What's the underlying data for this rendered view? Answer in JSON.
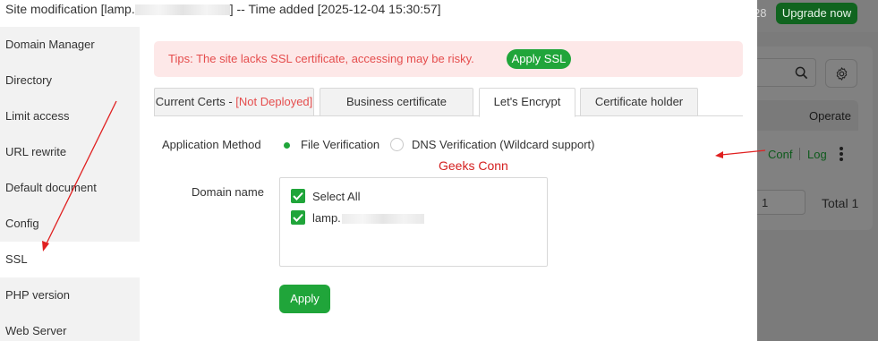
{
  "background": {
    "top_number": "28",
    "upgrade_label": "Upgrade now",
    "operate_header": "Operate",
    "conf_link": "Conf",
    "log_link": "Log",
    "page_number": "1",
    "total_label": "Total 1"
  },
  "modal": {
    "title_prefix": "Site modification [lamp.",
    "title_suffix": "] -- Time added [2025-12-04 15:30:57]"
  },
  "sidebar": {
    "items": [
      {
        "label": "Domain Manager",
        "active": false
      },
      {
        "label": "Directory",
        "active": false
      },
      {
        "label": "Limit access",
        "active": false
      },
      {
        "label": "URL rewrite",
        "active": false
      },
      {
        "label": "Default document",
        "active": false
      },
      {
        "label": "Config",
        "active": false
      },
      {
        "label": "SSL",
        "active": true
      },
      {
        "label": "PHP version",
        "active": false
      },
      {
        "label": "Web Server",
        "active": false
      }
    ]
  },
  "tips": {
    "text": "Tips: The site lacks SSL certificate, accessing may be risky.",
    "button": "Apply SSL"
  },
  "tabs": [
    {
      "label": "Current Certs - ",
      "badge": "[Not Deployed]",
      "active": false
    },
    {
      "label": "Business certificate",
      "badge": "",
      "active": false
    },
    {
      "label": "Let's Encrypt",
      "badge": "",
      "active": true
    },
    {
      "label": "Certificate holder",
      "badge": "",
      "active": false
    }
  ],
  "form": {
    "method_label": "Application Method",
    "method_options": [
      {
        "label": "File Verification",
        "selected": true
      },
      {
        "label": "DNS Verification (Wildcard support)",
        "selected": false
      }
    ],
    "watermark": "Geeks Conn",
    "domain_label": "Domain name",
    "select_all": "Select All",
    "domain_prefix": "lamp.",
    "apply_button": "Apply"
  },
  "colors": {
    "accent": "#20a53a",
    "warning": "#e54d4d",
    "annotation": "#e02020"
  }
}
